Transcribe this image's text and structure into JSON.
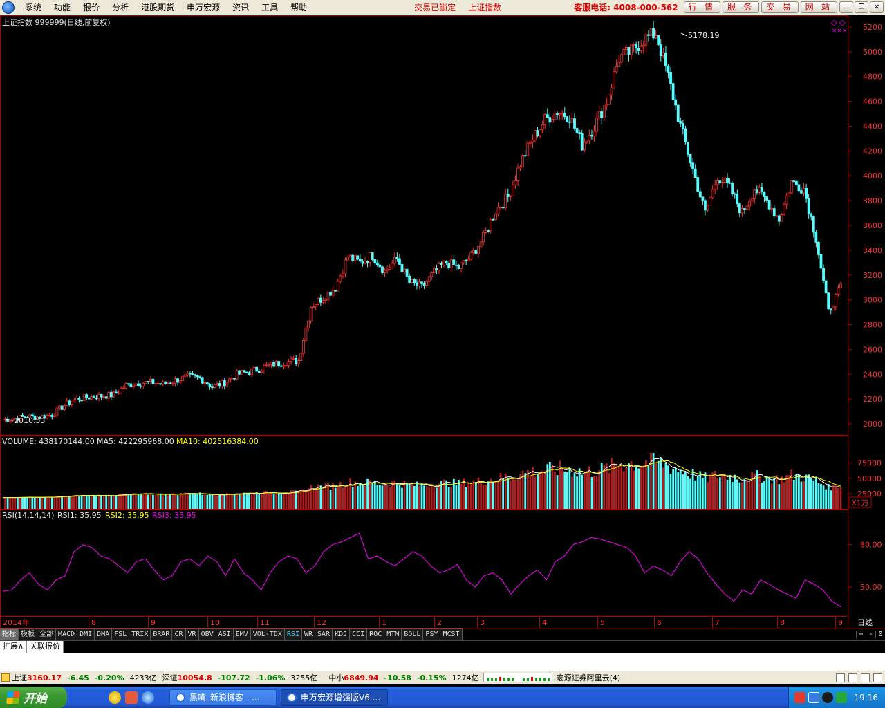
{
  "menu": {
    "items": [
      "系统",
      "功能",
      "报价",
      "分析",
      "港股期货",
      "申万宏源",
      "资讯",
      "工具",
      "帮助"
    ],
    "status_locked": "交易已锁定",
    "status_index": "上证指数",
    "hotline": "客服电话: 4008-000-562",
    "buttons": [
      "行 情",
      "服 务",
      "交 易",
      "网 站"
    ],
    "window_buttons": [
      "minimize-icon",
      "restore-icon",
      "close-icon"
    ]
  },
  "chart_header": {
    "title": "上证指数 999999(日线,前复权)",
    "max_label": "5178.19",
    "min_label": "2010.53"
  },
  "volume_header": {
    "volume_label": "VOLUME: 438170144.00",
    "ma5_label": "MA5: 422295968.00",
    "ma10_label": "MA10: 402516384.00",
    "unit_label": "X1万"
  },
  "rsi_header": {
    "name": "RSI(14,14,14)",
    "rsi1": "RSI1: 35.95",
    "rsi2": "RSI2: 35.95",
    "rsi3": "RSI3: 35.95"
  },
  "x_axis": {
    "labels": [
      "2014年",
      "8",
      "9",
      "10",
      "11",
      "12",
      "1",
      "2",
      "3",
      "4",
      "5",
      "6",
      "7",
      "8",
      "9"
    ],
    "period": "日线"
  },
  "indicator_tabs": [
    "指标",
    "模板",
    "全部",
    "MACD",
    "DMI",
    "DMA",
    "FSL",
    "TRIX",
    "BRAR",
    "CR",
    "VR",
    "OBV",
    "ASI",
    "EMV",
    "VOL-TDX",
    "RSI",
    "WR",
    "SAR",
    "KDJ",
    "CCI",
    "ROC",
    "MTM",
    "BOLL",
    "PSY",
    "MCST"
  ],
  "indicator_tabs_active": "RSI",
  "tab_controls": [
    "+",
    "-",
    "0"
  ],
  "ext_tabs": [
    "扩展∧",
    "关联报价"
  ],
  "ticker": {
    "sh_name": "上证",
    "sh_price": "3160.17",
    "sh_change": "-6.45",
    "sh_pct": "-0.20%",
    "sh_amount": "4233亿",
    "sz_name": "深证",
    "sz_price": "10054.8",
    "sz_change": "-107.72",
    "sz_pct": "-1.06%",
    "sz_amount": "3255亿",
    "zx_name": "中小",
    "zx_price": "6849.94",
    "zx_change": "-10.58",
    "zx_pct": "-0.15%",
    "zx_amount": "1274亿",
    "broker": "宏源证券阿里云(4)"
  },
  "taskbar": {
    "start": "开始",
    "tasks": [
      "黑嘴_新浪博客 - ...",
      "申万宏源增强版V6...."
    ],
    "clock": "19:16"
  },
  "chart_data": [
    {
      "type": "candlestick",
      "title": "上证指数 999999(日线,前复权)",
      "period": "daily",
      "x_range": [
        "2014-07",
        "2015-09"
      ],
      "y_ticks": [
        2000,
        2200,
        2400,
        2600,
        2800,
        3000,
        3200,
        3400,
        3600,
        3800,
        4000,
        4200,
        4400,
        4600,
        4800,
        5000,
        5200
      ],
      "ylim": [
        1950,
        5250
      ],
      "annotated_max": 5178.19,
      "annotated_min": 2010.53,
      "weekly_closes_approx": [
        2030,
        2045,
        2060,
        2055,
        2075,
        2150,
        2200,
        2215,
        2225,
        2235,
        2310,
        2330,
        2335,
        2320,
        2350,
        2380,
        2370,
        2300,
        2330,
        2400,
        2420,
        2450,
        2480,
        2500,
        2510,
        2950,
        3020,
        3100,
        3350,
        3300,
        3360,
        3230,
        3330,
        3140,
        3100,
        3220,
        3300,
        3260,
        3350,
        3500,
        3720,
        3830,
        4100,
        4300,
        4450,
        4520,
        4480,
        4250,
        4400,
        4600,
        4950,
        5000,
        5100,
        5150,
        4800,
        4400,
        4050,
        3700,
        4000,
        3900,
        3700,
        3900,
        3800,
        3650,
        3950,
        3900,
        3500,
        2900,
        3100
      ]
    },
    {
      "type": "bar",
      "title": "VOLUME",
      "unit": "X1万",
      "y_ticks": [
        25000,
        50000,
        75000
      ],
      "series": [
        {
          "name": "VOLUME",
          "last": 438170144.0
        },
        {
          "name": "MA5",
          "last": 422295968.0
        },
        {
          "name": "MA10",
          "last": 402516384.0
        }
      ]
    },
    {
      "type": "line",
      "title": "RSI(14,14,14)",
      "y_ticks": [
        50.0,
        80.0
      ],
      "series": [
        {
          "name": "RSI1",
          "last": 35.95
        },
        {
          "name": "RSI2",
          "last": 35.95
        },
        {
          "name": "RSI3",
          "last": 35.95
        }
      ],
      "values_approx": [
        47,
        48,
        55,
        60,
        52,
        48,
        55,
        58,
        75,
        80,
        78,
        72,
        70,
        65,
        60,
        68,
        70,
        62,
        55,
        58,
        68,
        70,
        65,
        72,
        68,
        58,
        70,
        60,
        55,
        48,
        60,
        68,
        72,
        70,
        60,
        65,
        75,
        80,
        82,
        85,
        88,
        70,
        72,
        68,
        65,
        70,
        75,
        72,
        65,
        60,
        62,
        66,
        55,
        50,
        58,
        60,
        55,
        45,
        52,
        58,
        62,
        55,
        68,
        72,
        80,
        82,
        85,
        84,
        82,
        80,
        78,
        72,
        60,
        65,
        62,
        58,
        68,
        75,
        70,
        60,
        52,
        45,
        40,
        48,
        45,
        55,
        52,
        48,
        45,
        42,
        55,
        52,
        48,
        40,
        36
      ]
    },
    {
      "colors": {
        "up": "#ff3030",
        "down": "#54ffff",
        "ma5": "#ffffff",
        "ma10": "#ffff00",
        "rsi": "#ff00ff",
        "axis": "#b00000"
      }
    }
  ]
}
